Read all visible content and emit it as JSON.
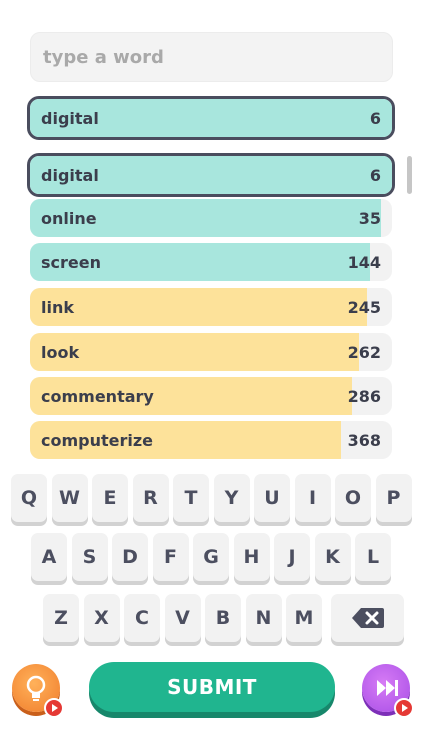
{
  "search": {
    "placeholder": "type a word"
  },
  "current_guess": {
    "word": "digital",
    "rank": "6"
  },
  "guesses": [
    {
      "word": "digital",
      "rank": "6",
      "fill": 1.0,
      "color": "#a8e6dd",
      "selected": true
    },
    {
      "word": "online",
      "rank": "35",
      "fill": 0.97,
      "color": "#a8e6dd"
    },
    {
      "word": "screen",
      "rank": "144",
      "fill": 0.94,
      "color": "#a8e6dd"
    },
    {
      "word": "link",
      "rank": "245",
      "fill": 0.93,
      "color": "#fde29a"
    },
    {
      "word": "look",
      "rank": "262",
      "fill": 0.91,
      "color": "#fde29a"
    },
    {
      "word": "commentary",
      "rank": "286",
      "fill": 0.89,
      "color": "#fde29a"
    },
    {
      "word": "computerize",
      "rank": "368",
      "fill": 0.86,
      "color": "#fde29a"
    }
  ],
  "keyboard": {
    "row1": [
      "Q",
      "W",
      "E",
      "R",
      "T",
      "Y",
      "U",
      "I",
      "O",
      "P"
    ],
    "row2": [
      "A",
      "S",
      "D",
      "F",
      "G",
      "H",
      "J",
      "K",
      "L"
    ],
    "row3": [
      "Z",
      "X",
      "C",
      "V",
      "B",
      "N",
      "M"
    ]
  },
  "actions": {
    "submit_label": "SUBMIT"
  },
  "colors": {
    "green": "#a8e6dd",
    "yellow": "#fde29a",
    "submit": "#20b58f"
  }
}
